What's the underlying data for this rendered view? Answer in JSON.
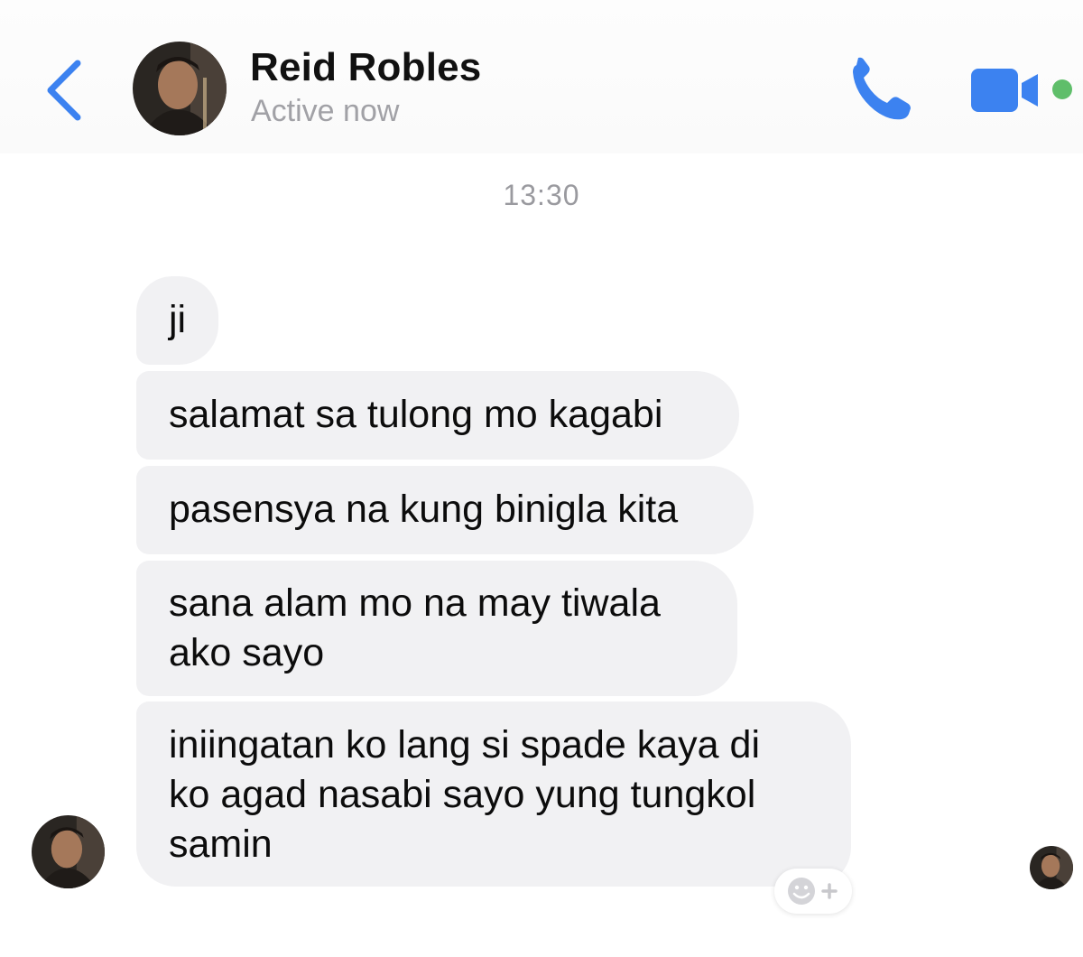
{
  "header": {
    "back_icon": "chevron-left-icon",
    "contact_name": "Reid Robles",
    "status": "Active now",
    "call_icon": "phone-icon",
    "video_icon": "video-camera-icon",
    "online_indicator_color": "#5fbe6a",
    "accent_color": "#3c82f0"
  },
  "conversation": {
    "timestamp": "13:30",
    "messages": [
      {
        "lines": [
          "ji"
        ]
      },
      {
        "lines": [
          "salamat sa tulong mo kagabi"
        ]
      },
      {
        "lines": [
          "pasensya na kung binigla kita"
        ]
      },
      {
        "lines": [
          "sana alam mo na may tiwala",
          "ako sayo"
        ]
      },
      {
        "lines": [
          "iniingatan ko lang si spade kaya di",
          "ko agad nasabi sayo yung tungkol",
          "samin"
        ]
      }
    ],
    "reaction_icon": "add-reaction-icon",
    "bubble_color": "#f1f1f3"
  }
}
